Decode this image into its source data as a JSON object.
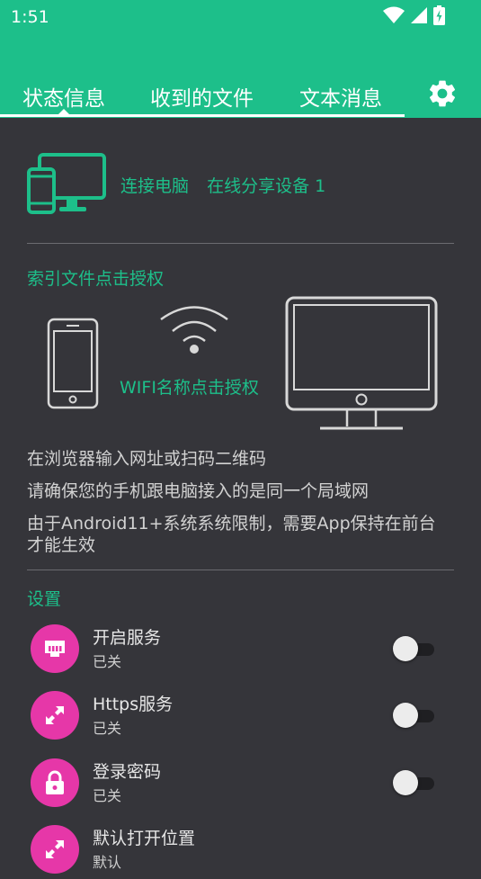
{
  "status_bar": {
    "time": "1:51",
    "icons": [
      "wifi-icon",
      "signal-icon",
      "battery-charging-icon"
    ]
  },
  "tabs": [
    {
      "label": "状态信息",
      "active": true
    },
    {
      "label": "收到的文件",
      "active": false
    },
    {
      "label": "文本消息",
      "active": false
    }
  ],
  "colors": {
    "accent": "#1dbf8a",
    "background": "#35353a",
    "icon_circle": "#e637a8"
  },
  "connection": {
    "computer_label": "连接电脑",
    "share_label": "在线分享设备 1"
  },
  "authorize": {
    "title": "索引文件点击授权",
    "wifi_label": "WIFI名称点击授权"
  },
  "info_lines": [
    "在浏览器输入网址或扫码二维码",
    "请确保您的手机跟电脑接入的是同一个局域网",
    "由于Android11+系统系统限制，需要App保持在前台才能生效"
  ],
  "settings": {
    "title": "设置",
    "items": [
      {
        "title": "开启服务",
        "subtitle": "已关",
        "icon": "ethernet-icon",
        "toggle": false
      },
      {
        "title": "Https服务",
        "subtitle": "已关",
        "icon": "expand-arrows-icon",
        "toggle": false
      },
      {
        "title": "登录密码",
        "subtitle": "已关",
        "icon": "lock-icon",
        "toggle": false
      },
      {
        "title": "默认打开位置",
        "subtitle": "默认",
        "icon": "expand-arrows-icon"
      }
    ]
  }
}
